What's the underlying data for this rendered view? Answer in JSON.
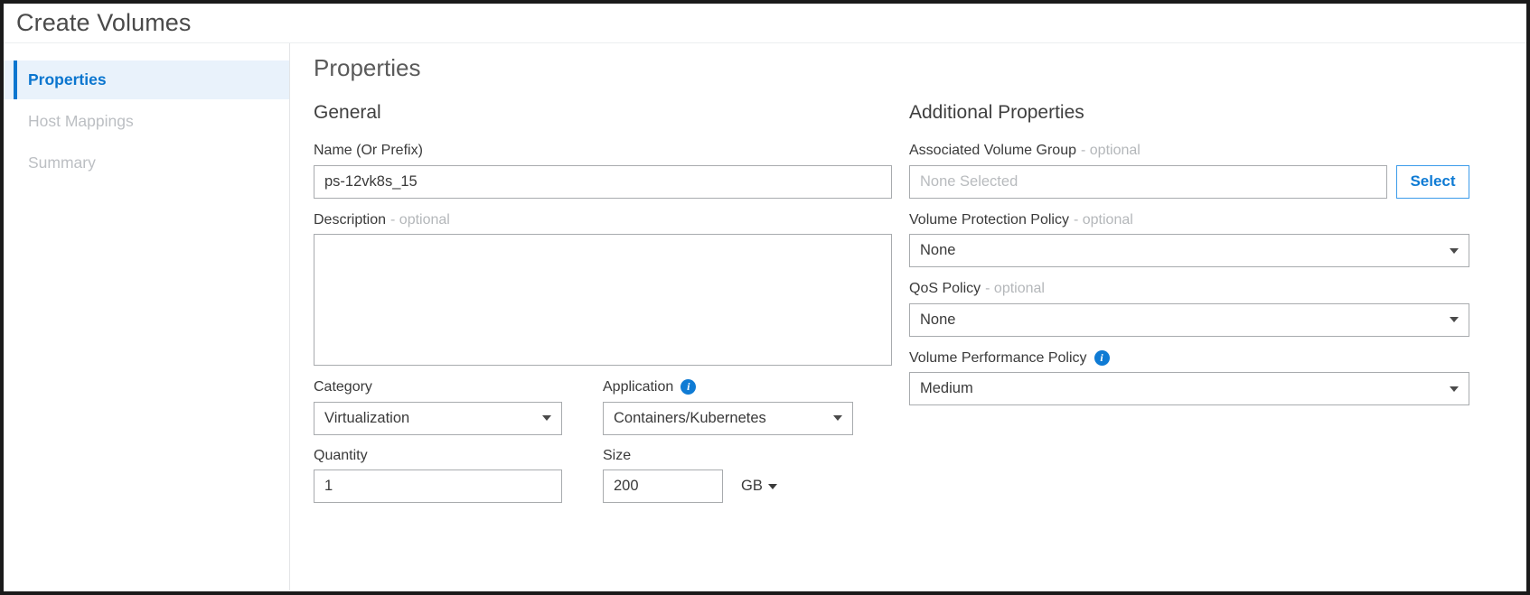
{
  "window": {
    "title": "Create Volumes"
  },
  "sidebar": {
    "items": [
      {
        "label": "Properties",
        "active": true
      },
      {
        "label": "Host Mappings",
        "active": false
      },
      {
        "label": "Summary",
        "active": false
      }
    ]
  },
  "main": {
    "section_title": "Properties",
    "left": {
      "heading": "General",
      "name": {
        "label": "Name (Or Prefix)",
        "value": "ps-12vk8s_15"
      },
      "description": {
        "label": "Description",
        "optional": "- optional",
        "value": ""
      },
      "category": {
        "label": "Category",
        "value": "Virtualization"
      },
      "application": {
        "label": "Application",
        "info_icon": "info-icon",
        "value": "Containers/Kubernetes"
      },
      "quantity": {
        "label": "Quantity",
        "value": "1"
      },
      "size": {
        "label": "Size",
        "value": "200",
        "unit": "GB"
      }
    },
    "right": {
      "heading": "Additional Properties",
      "volume_group": {
        "label": "Associated Volume Group",
        "optional": "- optional",
        "placeholder": "None Selected",
        "value": "",
        "button_label": "Select"
      },
      "protection_policy": {
        "label": "Volume Protection Policy",
        "optional": "- optional",
        "value": "None"
      },
      "qos_policy": {
        "label": "QoS Policy",
        "optional": "- optional",
        "value": "None"
      },
      "performance_policy": {
        "label": "Volume Performance Policy",
        "info_icon": "info-icon",
        "value": "Medium"
      }
    }
  },
  "colors": {
    "accent": "#0b76cf",
    "accent_light": "#e9f2fb",
    "info_blue": "#0f7bd4",
    "border": "#a8abae",
    "text": "#3a3a3a",
    "muted": "#b4b7ba"
  }
}
